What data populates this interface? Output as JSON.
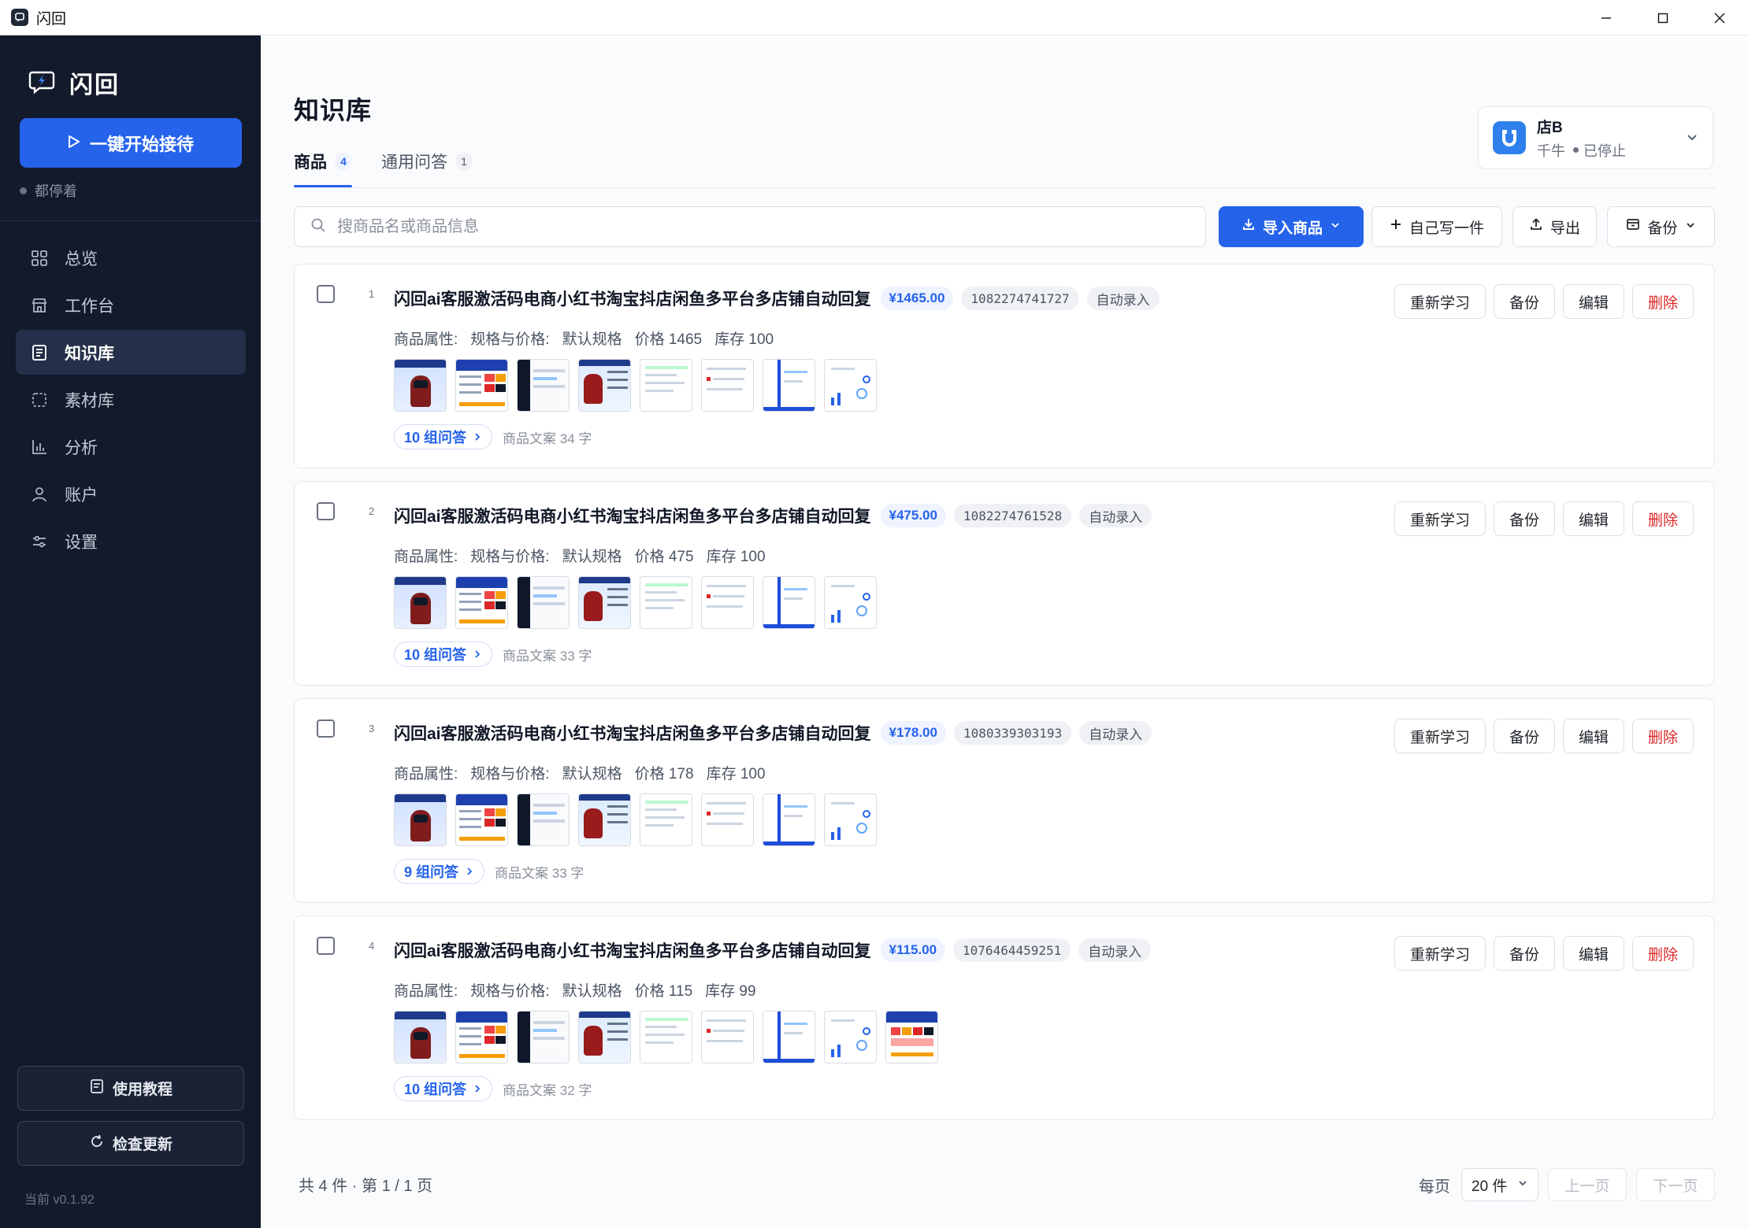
{
  "window": {
    "title": "闪回"
  },
  "sidebar": {
    "brand": "闪回",
    "start_button": "一键开始接待",
    "status": "都停着",
    "items": [
      {
        "label": "总览",
        "icon": "grid-icon"
      },
      {
        "label": "工作台",
        "icon": "store-icon"
      },
      {
        "label": "知识库",
        "icon": "document-icon"
      },
      {
        "label": "素材库",
        "icon": "dashed-square-icon"
      },
      {
        "label": "分析",
        "icon": "bar-chart-icon"
      },
      {
        "label": "账户",
        "icon": "user-icon"
      },
      {
        "label": "设置",
        "icon": "sliders-icon"
      }
    ],
    "active_item": "知识库",
    "tutorial_button": "使用教程",
    "update_button": "检查更新",
    "version": "当前 v0.1.92"
  },
  "main": {
    "title": "知识库",
    "tabs": [
      {
        "label": "商品",
        "count": "4"
      },
      {
        "label": "通用问答",
        "count": "1"
      }
    ],
    "shop": {
      "name": "店B",
      "platform": "千牛",
      "status": "已停止"
    },
    "search": {
      "placeholder": "搜商品名或商品信息"
    },
    "toolbar": {
      "import": "导入商品",
      "write": "自己写一件",
      "export": "导出",
      "backup": "备份"
    },
    "actions": {
      "relearn": "重新学习",
      "backup": "备份",
      "edit": "编辑",
      "delete": "删除"
    },
    "attr_label": "商品属性:",
    "spec_label": "规格与价格:",
    "products": [
      {
        "index": "1",
        "title": "闪回ai客服激活码电商小红书淘宝抖店闲鱼多平台多店铺自动回复",
        "price": "¥1465.00",
        "id": "1082274741727",
        "source": "自动录入",
        "spec": "默认规格",
        "price_text": "价格 1465",
        "stock": "库存 100",
        "qa": "10 组问答",
        "copy": "商品文案 34 字"
      },
      {
        "index": "2",
        "title": "闪回ai客服激活码电商小红书淘宝抖店闲鱼多平台多店铺自动回复",
        "price": "¥475.00",
        "id": "1082274761528",
        "source": "自动录入",
        "spec": "默认规格",
        "price_text": "价格 475",
        "stock": "库存 100",
        "qa": "10 组问答",
        "copy": "商品文案 33 字"
      },
      {
        "index": "3",
        "title": "闪回ai客服激活码电商小红书淘宝抖店闲鱼多平台多店铺自动回复",
        "price": "¥178.00",
        "id": "1080339303193",
        "source": "自动录入",
        "spec": "默认规格",
        "price_text": "价格 178",
        "stock": "库存 100",
        "qa": "9 组问答",
        "copy": "商品文案 33 字"
      },
      {
        "index": "4",
        "title": "闪回ai客服激活码电商小红书淘宝抖店闲鱼多平台多店铺自动回复",
        "price": "¥115.00",
        "id": "1076464459251",
        "source": "自动录入",
        "spec": "默认规格",
        "price_text": "价格 115",
        "stock": "库存 99",
        "qa": "10 组问答",
        "copy": "商品文案 32 字"
      }
    ],
    "footer": {
      "summary": "共 4 件 · 第 1 / 1 页",
      "per_page_label": "每页",
      "per_page": "20 件",
      "prev": "上一页",
      "next": "下一页"
    }
  },
  "colors": {
    "accent": "#2563eb",
    "sidebar_bg": "#131a2b",
    "danger": "#dc2626"
  }
}
